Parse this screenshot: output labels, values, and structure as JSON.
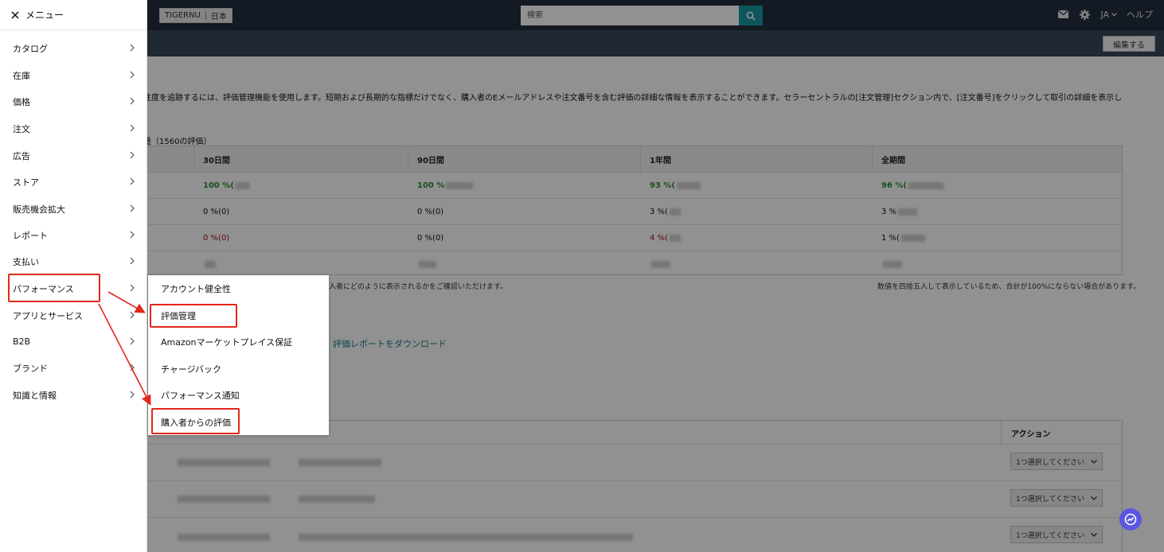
{
  "header": {
    "store_name": "TIGERNU",
    "marketplace": "日本",
    "search_placeholder": "検索",
    "language": "JA",
    "help_label": "ヘルプ",
    "edit_button": "編集する"
  },
  "page": {
    "intro_text": "注度を追跡するには、評価管理機能を使用します。短期および長期的な指標だけでなく、購入者のEメールアドレスや注文番号を含む評価の詳細な情報を表示することができます。セラーセントラルの[注文管理]セクション内で、[注文番号]をクリックして取引の詳細を表示し",
    "table_title": "量（1560の評価）",
    "feedback_table": {
      "headers": [
        "30日間",
        "90日間",
        "1年間",
        "全期間"
      ],
      "rows": [
        [
          "100 %(",
          "100 %",
          "93 %(",
          "96 %("
        ],
        [
          "0 %(0)",
          "0 %(0)",
          "3 %(",
          "3 %"
        ],
        [
          "0 %(0)",
          "0 %(0)",
          "4 %(",
          "1 %("
        ]
      ]
    },
    "note_left": "入者にどのように表示されるかをご確認いただけます。",
    "note_right": "数値を四捨五入して表示しているため、合計が100%にならない場合があります。",
    "download_link": "評価レポートをダウンロード",
    "list_action_header": "アクション",
    "action_select_placeholder": "1つ選択してください"
  },
  "menu": {
    "close_label": "メニュー",
    "items": [
      {
        "label": "カタログ"
      },
      {
        "label": "在庫"
      },
      {
        "label": "価格"
      },
      {
        "label": "注文"
      },
      {
        "label": "広告"
      },
      {
        "label": "ストア"
      },
      {
        "label": "販売機会拡大"
      },
      {
        "label": "レポート"
      },
      {
        "label": "支払い"
      },
      {
        "label": "パフォーマンス"
      },
      {
        "label": "アプリとサービス"
      },
      {
        "label": "B2B"
      },
      {
        "label": "ブランド"
      },
      {
        "label": "知識と情報"
      }
    ],
    "active_item": "パフォーマンス",
    "submenu": {
      "items": [
        {
          "label": "アカウント健全性"
        },
        {
          "label": "評価管理"
        },
        {
          "label": "Amazonマーケットプレイス保証"
        },
        {
          "label": "チャージバック"
        },
        {
          "label": "パフォーマンス通知"
        },
        {
          "label": "購入者からの評価"
        }
      ],
      "highlighted": [
        "評価管理",
        "購入者からの評価"
      ]
    }
  },
  "colors": {
    "highlight": "#e2271b",
    "topbar": "#232f3e",
    "positive": "#2e8b2e",
    "negative": "#a31515",
    "accent": "#1a98a8"
  }
}
